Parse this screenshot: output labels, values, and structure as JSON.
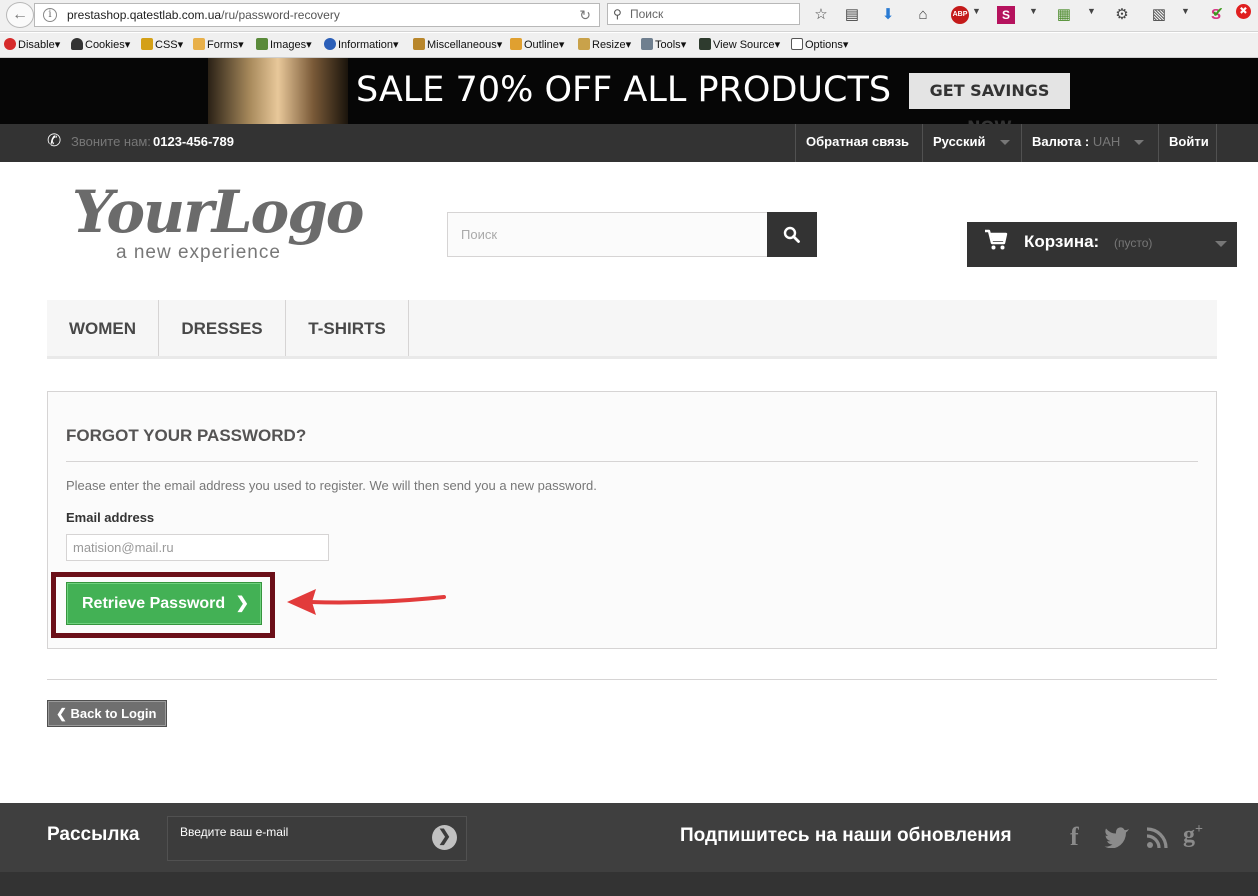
{
  "browser": {
    "url_host": "prestashop.qatestlab.com.ua",
    "url_path": "/ru/password-recovery",
    "search_placeholder": "Поиск"
  },
  "dev_toolbar": {
    "items": [
      "Disable",
      "Cookies",
      "CSS",
      "Forms",
      "Images",
      "Information",
      "Miscellaneous",
      "Outline",
      "Resize",
      "Tools",
      "View Source",
      "Options"
    ]
  },
  "promo": {
    "text": "SALE 70% OFF ALL PRODUCTS",
    "button": "GET SAVINGS NOW"
  },
  "topnav": {
    "call_label": "Звоните нам:",
    "phone": "0123-456-789",
    "contact": "Обратная связь",
    "language": "Русский",
    "currency_label": "Валюта :",
    "currency_value": "UAH",
    "login": "Войти"
  },
  "header": {
    "logo_main": "YourLogo",
    "logo_sub": "a new experience",
    "search_placeholder": "Поиск",
    "cart_label": "Корзина:",
    "cart_status": "(пусто)"
  },
  "menu": {
    "items": [
      "WOMEN",
      "DRESSES",
      "T-SHIRTS"
    ]
  },
  "form": {
    "title": "FORGOT YOUR PASSWORD?",
    "intro": "Please enter the email address you used to register. We will then send you a new password.",
    "email_label": "Email address",
    "email_value": "matision@mail.ru",
    "submit": "Retrieve Password",
    "back": "Back to Login"
  },
  "footer": {
    "newsletter_title": "Рассылка",
    "newsletter_placeholder": "Введите ваш e-mail",
    "follow_title": "Подпишитесь на наши обновления",
    "social_icons": [
      "facebook-icon",
      "twitter-icon",
      "rss-icon",
      "google-plus-icon"
    ]
  },
  "colors": {
    "accent_green": "#43b155",
    "highlight_border": "#6b0f18",
    "annotation_arrow": "#e23b3b",
    "dark_bar": "#333333"
  }
}
